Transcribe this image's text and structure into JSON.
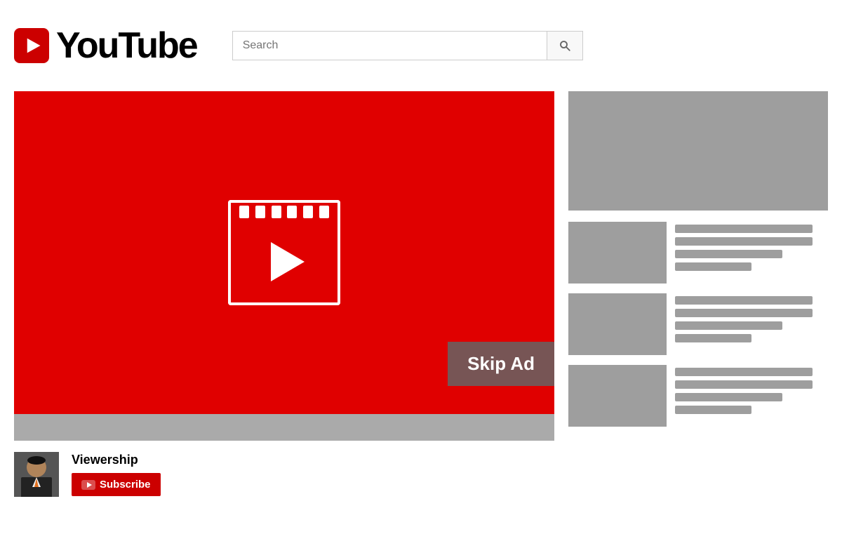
{
  "header": {
    "logo_text": "YouTube",
    "search_placeholder": "Search",
    "search_button_label": "Search"
  },
  "video": {
    "skip_ad_label": "Skip Ad",
    "progress_bar_label": "Video progress bar"
  },
  "channel": {
    "name": "Viewership",
    "subscribe_label": "Subscribe"
  },
  "sidebar": {
    "banner_label": "Advertisement banner",
    "related_items": [
      {
        "id": 1
      },
      {
        "id": 2
      },
      {
        "id": 3
      }
    ]
  },
  "colors": {
    "red": "#cc0000",
    "gray": "#9e9e9e",
    "dark": "#555555"
  }
}
